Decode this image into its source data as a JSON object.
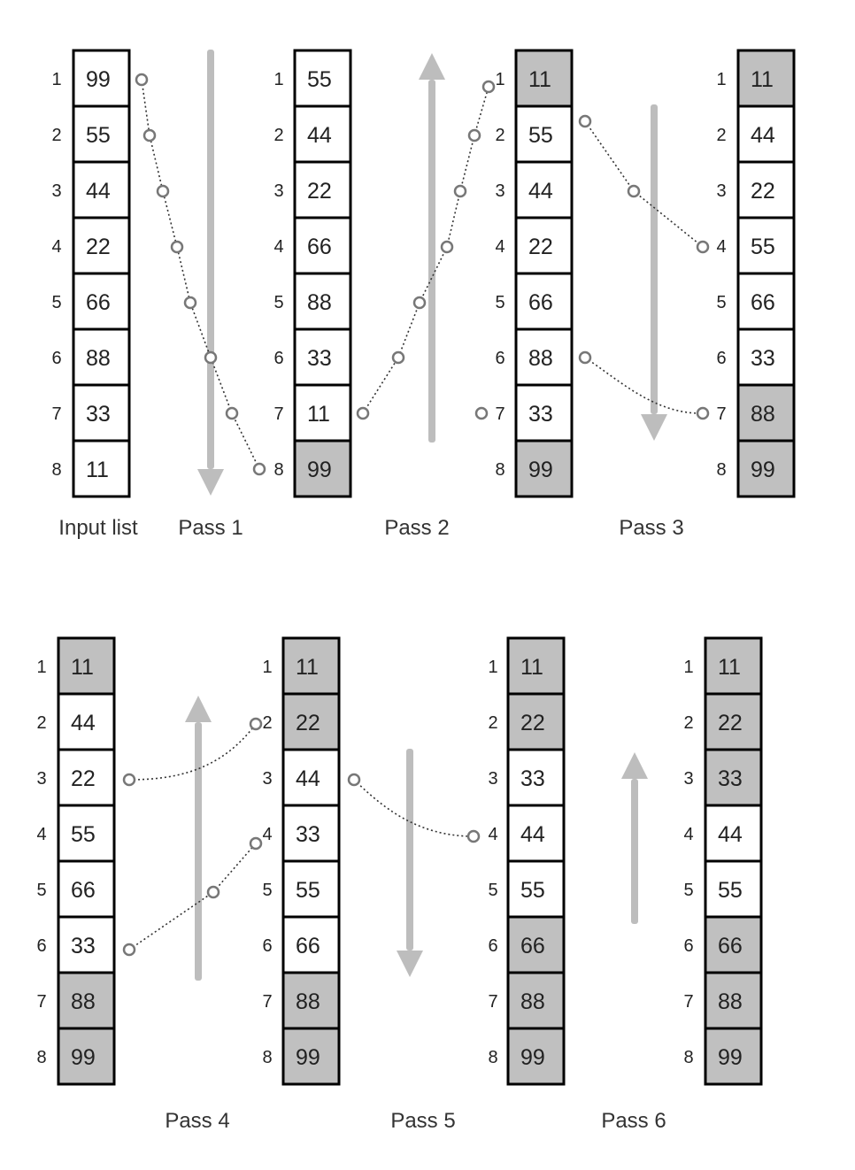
{
  "colors": {
    "sorted_fill": "#c0c0c0",
    "unsorted_fill": "#ffffff",
    "arrow": "#bdbdbd",
    "node_stroke": "#777777"
  },
  "lists": [
    {
      "id": "input",
      "values": [
        99,
        55,
        44,
        22,
        66,
        88,
        33,
        11
      ],
      "sorted": [
        false,
        false,
        false,
        false,
        false,
        false,
        false,
        false
      ]
    },
    {
      "id": "after-pass-1",
      "values": [
        55,
        44,
        22,
        66,
        88,
        33,
        11,
        99
      ],
      "sorted": [
        false,
        false,
        false,
        false,
        false,
        false,
        false,
        true
      ]
    },
    {
      "id": "after-pass-2",
      "values": [
        11,
        55,
        44,
        22,
        66,
        88,
        33,
        99
      ],
      "sorted": [
        true,
        false,
        false,
        false,
        false,
        false,
        false,
        true
      ]
    },
    {
      "id": "after-pass-3",
      "values": [
        11,
        44,
        22,
        55,
        66,
        33,
        88,
        99
      ],
      "sorted": [
        true,
        false,
        false,
        false,
        false,
        false,
        true,
        true
      ]
    },
    {
      "id": "before-pass-4",
      "values": [
        11,
        44,
        22,
        55,
        66,
        33,
        88,
        99
      ],
      "sorted": [
        true,
        false,
        false,
        false,
        false,
        false,
        true,
        true
      ]
    },
    {
      "id": "after-pass-4",
      "values": [
        11,
        22,
        44,
        33,
        55,
        66,
        88,
        99
      ],
      "sorted": [
        true,
        true,
        false,
        false,
        false,
        false,
        true,
        true
      ]
    },
    {
      "id": "after-pass-5",
      "values": [
        11,
        22,
        33,
        44,
        55,
        66,
        88,
        99
      ],
      "sorted": [
        true,
        true,
        false,
        false,
        false,
        true,
        true,
        true
      ]
    },
    {
      "id": "after-pass-6",
      "values": [
        11,
        22,
        33,
        44,
        55,
        66,
        88,
        99
      ],
      "sorted": [
        true,
        true,
        true,
        false,
        false,
        true,
        true,
        true
      ]
    }
  ],
  "index_labels": [
    "1",
    "2",
    "3",
    "4",
    "5",
    "6",
    "7",
    "8"
  ],
  "captions": {
    "input": "Input list",
    "pass1": "Pass 1",
    "pass2": "Pass 2",
    "pass3": "Pass 3",
    "pass4": "Pass 4",
    "pass5": "Pass 5",
    "pass6": "Pass 6"
  },
  "passes": [
    {
      "name": "Pass 1",
      "direction": "down",
      "moves": [
        {
          "from": 1,
          "to": 8,
          "value": 99
        }
      ]
    },
    {
      "name": "Pass 2",
      "direction": "up",
      "moves": [
        {
          "from": 7,
          "to": 1,
          "value": 11
        }
      ]
    },
    {
      "name": "Pass 3",
      "direction": "down",
      "moves": [
        {
          "from": 2,
          "to": 4,
          "value": 55
        },
        {
          "from": 6,
          "to": 7,
          "value": 88
        }
      ]
    },
    {
      "name": "Pass 4",
      "direction": "up",
      "moves": [
        {
          "from": 3,
          "to": 2,
          "value": 22
        },
        {
          "from": 6,
          "to": 4,
          "value": 33
        }
      ]
    },
    {
      "name": "Pass 5",
      "direction": "down",
      "moves": [
        {
          "from": 3,
          "to": 4,
          "value": 44
        }
      ]
    },
    {
      "name": "Pass 6",
      "direction": "up",
      "moves": []
    }
  ]
}
